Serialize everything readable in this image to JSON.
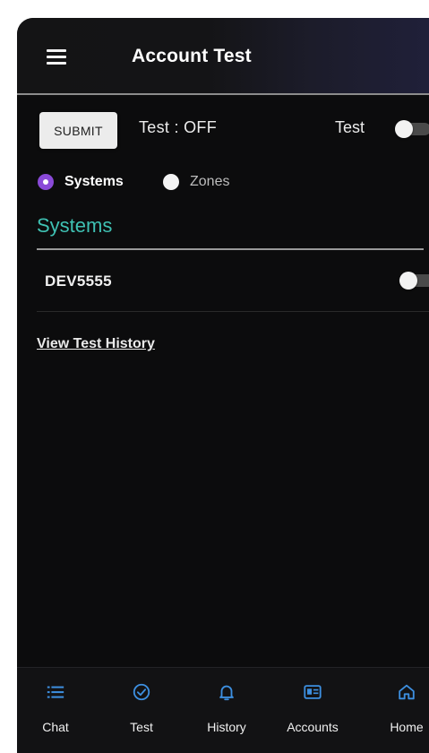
{
  "header": {
    "title": "Account Test"
  },
  "controls": {
    "submit_label": "SUBMIT",
    "test_status": "Test : OFF",
    "test_toggle_label": "Test",
    "test_toggle_on": false
  },
  "filter": {
    "options": [
      {
        "label": "Systems",
        "selected": true
      },
      {
        "label": "Zones",
        "selected": false
      }
    ]
  },
  "systems": {
    "heading": "Systems",
    "items": [
      {
        "name": "DEV5555",
        "toggle_on": false
      }
    ]
  },
  "links": {
    "view_history": "View Test History"
  },
  "bottom_nav": {
    "items": [
      {
        "label": "Chat",
        "icon": "list-icon"
      },
      {
        "label": "Test",
        "icon": "check-circle-icon"
      },
      {
        "label": "History",
        "icon": "bell-icon"
      },
      {
        "label": "Accounts",
        "icon": "id-card-icon"
      },
      {
        "label": "Home",
        "icon": "home-icon"
      }
    ]
  },
  "colors": {
    "background": "#0c0c0d",
    "accent_teal": "#3fc1b3",
    "nav_icon_blue": "#3d8fe0",
    "radio_purple": "#8a4ad8"
  }
}
